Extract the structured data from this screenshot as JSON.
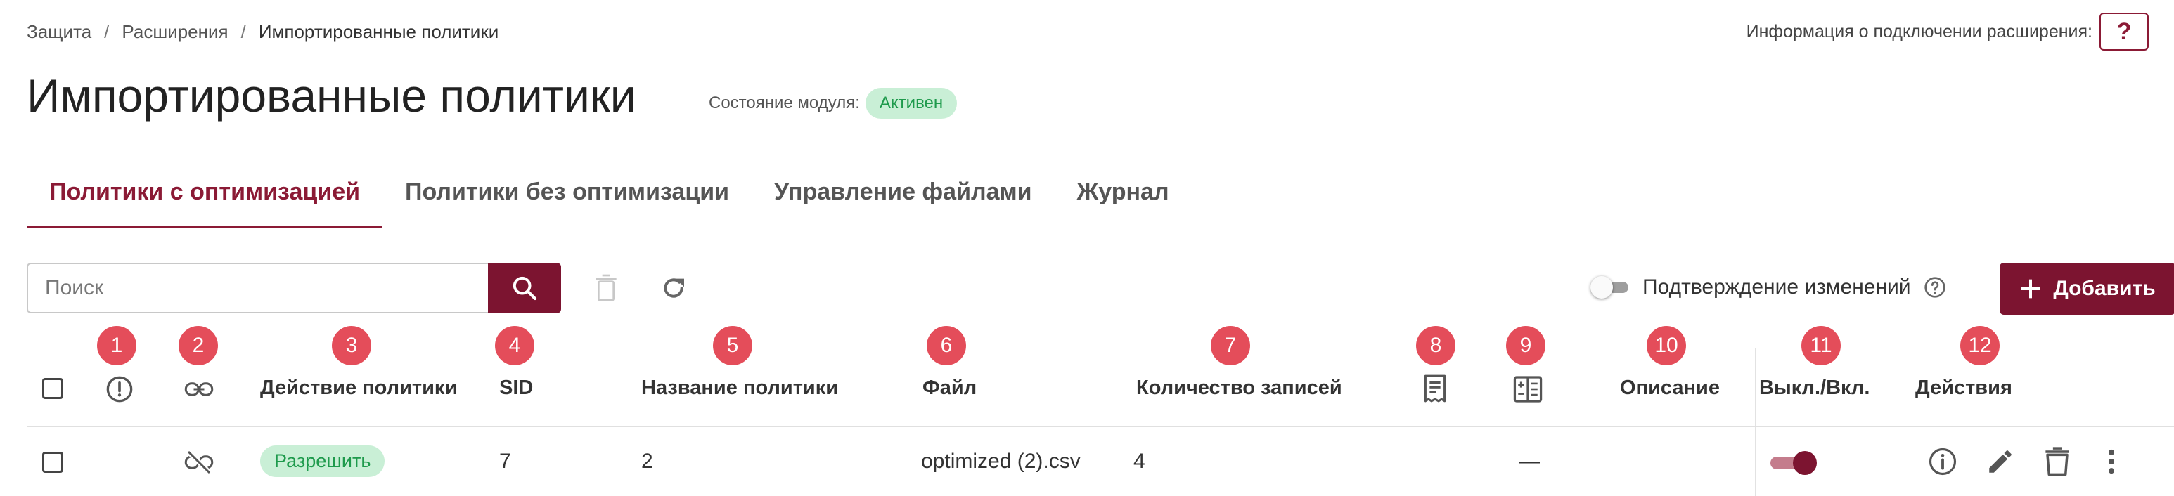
{
  "breadcrumb": {
    "items": [
      "Защита",
      "Расширения"
    ],
    "separator": "/",
    "current": "Импортированные политики"
  },
  "connection_info": {
    "label": "Информация о подключении расширения:",
    "help_label": "?"
  },
  "page_title": "Импортированные политики",
  "module_status": {
    "label": "Состояние модуля:",
    "value": "Активен"
  },
  "tabs": [
    {
      "label": "Политики с оптимизацией",
      "active": true
    },
    {
      "label": "Политики без оптимизации",
      "active": false
    },
    {
      "label": "Управление файлами",
      "active": false
    },
    {
      "label": "Журнал",
      "active": false
    }
  ],
  "toolbar": {
    "search_placeholder": "Поиск",
    "confirm_label": "Подтверждение изменений",
    "add_label": "Добавить",
    "icons": [
      "search-icon",
      "delete-icon",
      "refresh-icon",
      "help-circle-icon",
      "plus-icon"
    ]
  },
  "markers": [
    "1",
    "2",
    "3",
    "4",
    "5",
    "6",
    "7",
    "8",
    "9",
    "10",
    "11",
    "12"
  ],
  "columns": {
    "action": "Действие политики",
    "sid": "SID",
    "name": "Название политики",
    "file": "Файл",
    "count": "Количество записей",
    "description": "Описание",
    "toggle": "Выкл./Вкл.",
    "actions": "Действия"
  },
  "rows": [
    {
      "action": "Разрешить",
      "sid": "7",
      "name": "2",
      "file": "optimized (2).csv",
      "count": "4",
      "col9": "—",
      "enabled": true
    }
  ],
  "colors": {
    "accent": "#7c1430",
    "marker": "#e44d5a",
    "status_bg": "#c9efd6",
    "status_text": "#1e9a4c"
  }
}
